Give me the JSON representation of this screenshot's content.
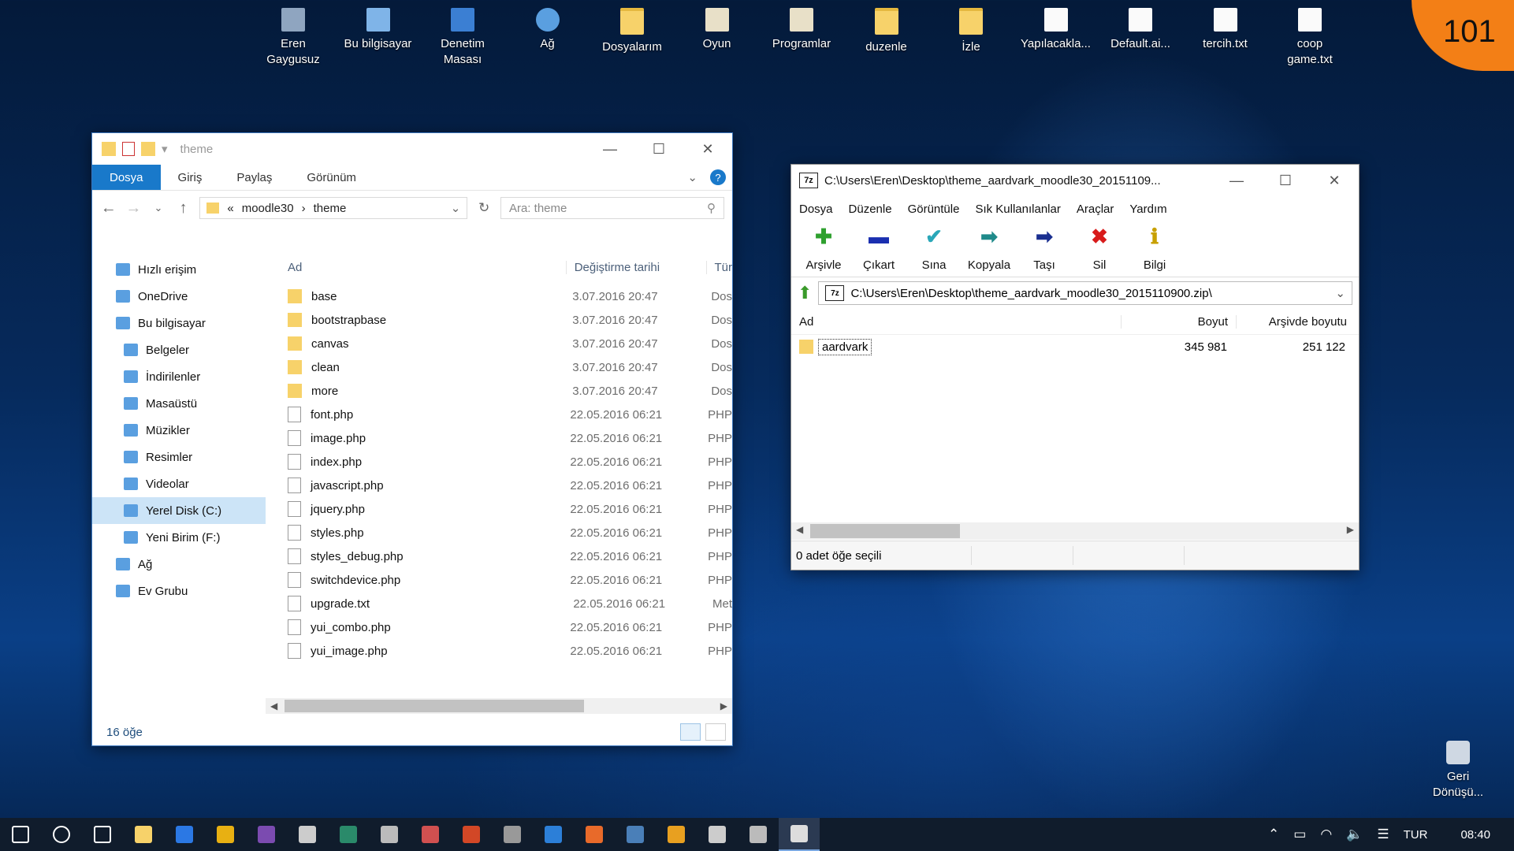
{
  "badge": "101",
  "desktop_icons": [
    {
      "label": "Eren\nGaygusuz",
      "icon": "user-folder-icon"
    },
    {
      "label": "Bu bilgisayar",
      "icon": "computer-icon"
    },
    {
      "label": "Denetim\nMasası",
      "icon": "control-panel-icon"
    },
    {
      "label": "Ağ",
      "icon": "network-icon"
    },
    {
      "label": "Dosyalarım",
      "icon": "folder-icon"
    },
    {
      "label": "Oyun",
      "icon": "game-icon"
    },
    {
      "label": "Programlar",
      "icon": "program-icon"
    },
    {
      "label": "duzenle",
      "icon": "folder-icon"
    },
    {
      "label": "İzle",
      "icon": "folder-icon"
    },
    {
      "label": "Yapılacakla...",
      "icon": "text-file-icon"
    },
    {
      "label": "Default.ai...",
      "icon": "file-icon"
    },
    {
      "label": "tercih.txt",
      "icon": "text-file-icon"
    },
    {
      "label": "coop\ngame.txt",
      "icon": "text-file-icon"
    }
  ],
  "recycle_bin": "Geri\nDönüşü...",
  "explorer": {
    "title": "theme",
    "ribbon_tabs": [
      "Dosya",
      "Giriş",
      "Paylaş",
      "Görünüm"
    ],
    "breadcrumb": {
      "prefix": "«",
      "path1": "moodle30",
      "sep": "›",
      "path2": "theme"
    },
    "search_placeholder": "Ara: theme",
    "sidebar": [
      {
        "label": "Hızlı erişim",
        "icon": "star-icon",
        "sub": false
      },
      {
        "label": "OneDrive",
        "icon": "cloud-icon",
        "sub": false
      },
      {
        "label": "Bu bilgisayar",
        "icon": "computer-icon",
        "sub": false
      },
      {
        "label": "Belgeler",
        "icon": "documents-icon",
        "sub": true
      },
      {
        "label": "İndirilenler",
        "icon": "download-icon",
        "sub": true
      },
      {
        "label": "Masaüstü",
        "icon": "desktop-icon",
        "sub": true
      },
      {
        "label": "Müzikler",
        "icon": "music-icon",
        "sub": true
      },
      {
        "label": "Resimler",
        "icon": "pictures-icon",
        "sub": true
      },
      {
        "label": "Videolar",
        "icon": "video-icon",
        "sub": true
      },
      {
        "label": "Yerel Disk (C:)",
        "icon": "drive-icon",
        "sub": true,
        "selected": true
      },
      {
        "label": "Yeni Birim (F:)",
        "icon": "drive-icon",
        "sub": true
      },
      {
        "label": "Ağ",
        "icon": "network-icon",
        "sub": false
      },
      {
        "label": "Ev Grubu",
        "icon": "homegroup-icon",
        "sub": false
      }
    ],
    "columns": {
      "name": "Ad",
      "date": "Değiştirme tarihi",
      "type": "Tür"
    },
    "files": [
      {
        "name": "base",
        "date": "3.07.2016 20:47",
        "type": "Dos",
        "kind": "folder"
      },
      {
        "name": "bootstrapbase",
        "date": "3.07.2016 20:47",
        "type": "Dos",
        "kind": "folder"
      },
      {
        "name": "canvas",
        "date": "3.07.2016 20:47",
        "type": "Dos",
        "kind": "folder"
      },
      {
        "name": "clean",
        "date": "3.07.2016 20:47",
        "type": "Dos",
        "kind": "folder"
      },
      {
        "name": "more",
        "date": "3.07.2016 20:47",
        "type": "Dos",
        "kind": "folder"
      },
      {
        "name": "font.php",
        "date": "22.05.2016 06:21",
        "type": "PHP",
        "kind": "file"
      },
      {
        "name": "image.php",
        "date": "22.05.2016 06:21",
        "type": "PHP",
        "kind": "file"
      },
      {
        "name": "index.php",
        "date": "22.05.2016 06:21",
        "type": "PHP",
        "kind": "file"
      },
      {
        "name": "javascript.php",
        "date": "22.05.2016 06:21",
        "type": "PHP",
        "kind": "file"
      },
      {
        "name": "jquery.php",
        "date": "22.05.2016 06:21",
        "type": "PHP",
        "kind": "file"
      },
      {
        "name": "styles.php",
        "date": "22.05.2016 06:21",
        "type": "PHP",
        "kind": "file"
      },
      {
        "name": "styles_debug.php",
        "date": "22.05.2016 06:21",
        "type": "PHP",
        "kind": "file"
      },
      {
        "name": "switchdevice.php",
        "date": "22.05.2016 06:21",
        "type": "PHP",
        "kind": "file"
      },
      {
        "name": "upgrade.txt",
        "date": "22.05.2016 06:21",
        "type": "Met",
        "kind": "file"
      },
      {
        "name": "yui_combo.php",
        "date": "22.05.2016 06:21",
        "type": "PHP",
        "kind": "file"
      },
      {
        "name": "yui_image.php",
        "date": "22.05.2016 06:21",
        "type": "PHP",
        "kind": "file"
      }
    ],
    "status": "16 öğe"
  },
  "zip": {
    "title": "C:\\Users\\Eren\\Desktop\\theme_aardvark_moodle30_20151109...",
    "logo": "7z",
    "menu": [
      "Dosya",
      "Düzenle",
      "Görüntüle",
      "Sık Kullanılanlar",
      "Araçlar",
      "Yardım"
    ],
    "tools": [
      {
        "label": "Arşivle",
        "glyph": "✚",
        "color": "#2ea02e",
        "icon": "add-icon"
      },
      {
        "label": "Çıkart",
        "glyph": "▬",
        "color": "#1a2fb0",
        "icon": "extract-icon"
      },
      {
        "label": "Sına",
        "glyph": "✔",
        "color": "#2aa7b8",
        "icon": "test-icon"
      },
      {
        "label": "Kopyala",
        "glyph": "➡",
        "color": "#1f8a8a",
        "icon": "copy-icon"
      },
      {
        "label": "Taşı",
        "glyph": "➡",
        "color": "#1a2f90",
        "icon": "move-icon"
      },
      {
        "label": "Sil",
        "glyph": "✖",
        "color": "#d81b1b",
        "icon": "delete-icon"
      },
      {
        "label": "Bilgi",
        "glyph": "ℹ",
        "color": "#c8a000",
        "icon": "info-icon"
      }
    ],
    "path": "C:\\Users\\Eren\\Desktop\\theme_aardvark_moodle30_2015110900.zip\\",
    "columns": {
      "name": "Ad",
      "size": "Boyut",
      "packed": "Arşivde boyutu"
    },
    "rows": [
      {
        "name": "aardvark",
        "size": "345 981",
        "packed": "251 122"
      }
    ],
    "status": "0 adet öğe seçili"
  },
  "taskbar": {
    "apps": [
      "start-icon",
      "search-icon",
      "task-view-icon",
      "file-explorer-icon",
      "edge-icon",
      "chrome-icon",
      "visual-studio-icon",
      "settings-app-icon",
      "terminal-icon",
      "media-icon",
      "game-app-icon",
      "powerpoint-icon",
      "clock-app-icon",
      "outlook-icon",
      "app-icon",
      "steam-icon",
      "app2-icon",
      "app3-icon",
      "app4-icon",
      "seven-zip-icon"
    ],
    "app_colors": [
      "#ffffff",
      "#ffffff",
      "#ffffff",
      "#f7d26a",
      "#2b78e4",
      "#e8b012",
      "#7b4bb0",
      "#cccccc",
      "#2a8a6a",
      "#bbbbbb",
      "#d05050",
      "#d24726",
      "#999999",
      "#2c7fd8",
      "#e86a2a",
      "#4a7fb8",
      "#e8a020",
      "#cccccc",
      "#bbbbbb",
      "#dddddd"
    ],
    "active_app": 19,
    "tray": {
      "language": "TUR",
      "time": "08:40"
    }
  }
}
